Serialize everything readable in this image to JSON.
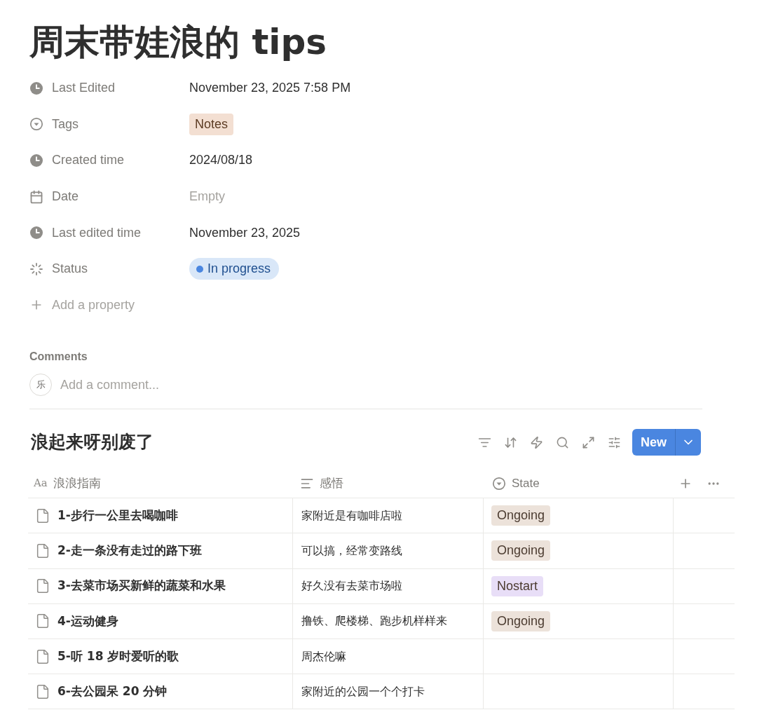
{
  "title": "周末带娃浪的 tips",
  "properties": [
    {
      "kind": "timestamp",
      "label": "Last Edited",
      "value": "November 23, 2025 7:58 PM"
    },
    {
      "kind": "select",
      "label": "Tags",
      "value": "Notes",
      "color": "#f3dfd2"
    },
    {
      "kind": "timestamp",
      "label": "Created time",
      "value": "2024/08/18"
    },
    {
      "kind": "date",
      "label": "Date",
      "value": "Empty"
    },
    {
      "kind": "timestamp",
      "label": "Last edited time",
      "value": "November 23, 2025"
    },
    {
      "kind": "status",
      "label": "Status",
      "value": "In progress",
      "color": "#4a86e0"
    }
  ],
  "add_property": "Add a property",
  "comments": {
    "heading": "Comments",
    "avatar": "乐",
    "placeholder": "Add a comment..."
  },
  "database": {
    "title": "浪起来呀别废了",
    "new_button": "New",
    "columns": [
      {
        "kind": "title",
        "type_mark": "Aa",
        "label": "浪浪指南"
      },
      {
        "kind": "text",
        "label": "感悟"
      },
      {
        "kind": "select",
        "label": "State"
      }
    ],
    "rows": [
      {
        "name": "1-步行一公里去喝咖啡",
        "note": "家附近是有咖啡店啦",
        "state": {
          "label": "Ongoing",
          "color": "#ece2da"
        }
      },
      {
        "name": "2-走一条没有走过的路下班",
        "note": "可以搞，经常变路线",
        "state": {
          "label": "Ongoing",
          "color": "#ece2da"
        }
      },
      {
        "name": "3-去菜市场买新鲜的蔬菜和水果",
        "note": "好久没有去菜市场啦",
        "state": {
          "label": "Nostart",
          "color": "#e8def7"
        }
      },
      {
        "name": "4-运动健身",
        "note": "撸铁、爬楼梯、跑步机样样来",
        "state": {
          "label": "Ongoing",
          "color": "#ece2da"
        }
      },
      {
        "name": "5-听 18 岁时爱听的歌",
        "note": "周杰伦嘛"
      },
      {
        "name": "6-去公园呆 20 分钟",
        "note": "家附近的公园一个个打卡"
      }
    ]
  }
}
